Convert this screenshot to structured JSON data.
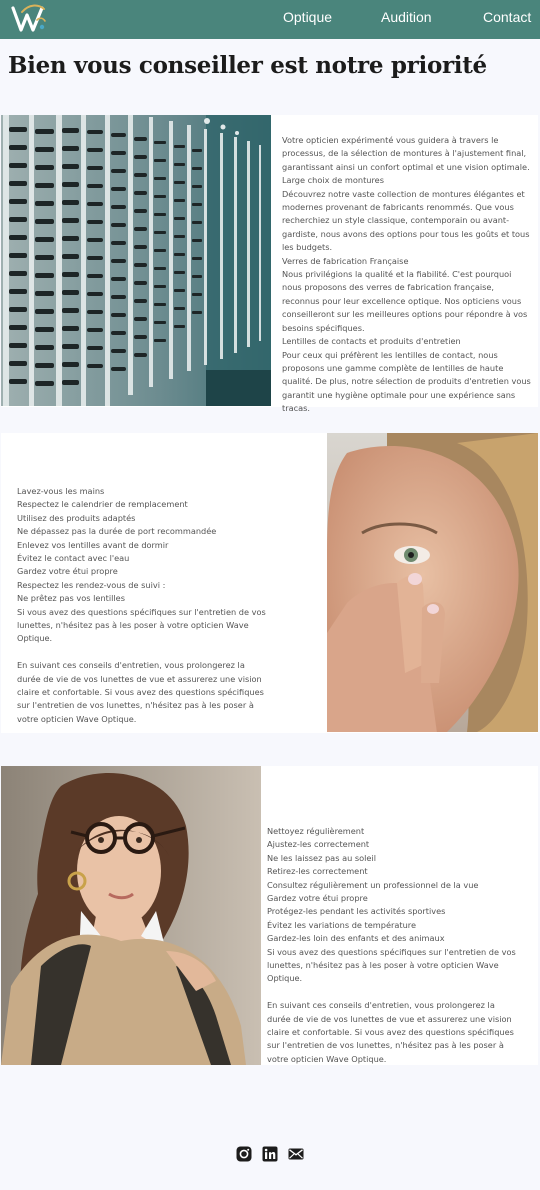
{
  "nav": {
    "logo_icon": "wave-optique-logo",
    "links": [
      "Optique",
      "Audition",
      "Contact"
    ],
    "colors": {
      "bar": "#4a857c",
      "text": "#ffffff"
    }
  },
  "page": {
    "title": "Bien vous conseiller est notre priorité"
  },
  "section1": {
    "image": "eyeglasses-display-photo",
    "paragraphs": [
      "Votre opticien expérimenté vous guidera à travers le processus, de la sélection de montures à l'ajustement final, garantissant ainsi un confort optimal et une vision optimale.",
      "Large choix de montures",
      "Découvrez notre vaste collection de montures élégantes et modernes provenant de fabricants renommés. Que vous recherchiez un style classique, contemporain ou avant-gardiste, nous avons des options pour tous les goûts et tous les budgets.",
      "Verres de fabrication Française",
      "Nous privilégions la qualité et la fiabilité. C'est pourquoi nous proposons des verres de fabrication française, reconnus pour leur excellence optique. Nos opticiens vous conseilleront sur les meilleures options pour répondre à vos besoins spécifiques.",
      "Lentilles de contacts et produits d'entretien",
      "Pour ceux qui préfèrent les lentilles de contact, nous proposons une gamme complète de lentilles de haute qualité. De plus, notre sélection de produits d'entretien vous garantit une hygiène optimale pour une expérience sans tracas."
    ]
  },
  "section2": {
    "image": "woman-contact-lens-photo",
    "lines": [
      "Lavez-vous les mains",
      "Respectez le calendrier de remplacement",
      "Utilisez des produits adaptés",
      "Ne dépassez pas la durée de port recommandée",
      "Enlevez vos lentilles avant de dormir",
      "Évitez le contact avec l'eau",
      "Gardez votre étui propre",
      "Respectez les rendez-vous de suivi :",
      "Ne prêtez pas vos lentilles",
      "Si vous avez des questions spécifiques sur l'entretien de vos lunettes, n'hésitez pas à les poser à votre opticien Wave Optique."
    ],
    "closing": "En suivant ces conseils d'entretien, vous prolongerez la durée de vie de vos lunettes de vue et assurerez une vision claire et confortable. Si vous avez des questions spécifiques sur l'entretien de vos lunettes, n'hésitez pas à les poser à votre opticien Wave Optique."
  },
  "section3": {
    "image": "woman-glasses-photo",
    "lines": [
      "Nettoyez régulièrement",
      "Ajustez-les correctement",
      "Ne les laissez pas au soleil",
      "Retirez-les correctement",
      "Consultez régulièrement un professionnel de la vue",
      "Gardez votre étui propre",
      "Protégez-les pendant les activités sportives",
      "Évitez les variations de température",
      "Gardez-les loin des enfants et des animaux",
      "Si vous avez des questions spécifiques sur l'entretien de vos lunettes, n'hésitez pas à les poser à votre opticien Wave Optique."
    ],
    "closing": "En suivant ces conseils d'entretien, vous prolongerez la durée de vie de vos lunettes de vue et assurerez une vision claire et confortable. Si vous avez des questions spécifiques sur l'entretien de vos lunettes, n'hésitez pas à les poser à votre opticien Wave Optique."
  },
  "footer": {
    "social_icons": [
      "instagram-icon",
      "linkedin-icon",
      "mail-icon"
    ]
  }
}
